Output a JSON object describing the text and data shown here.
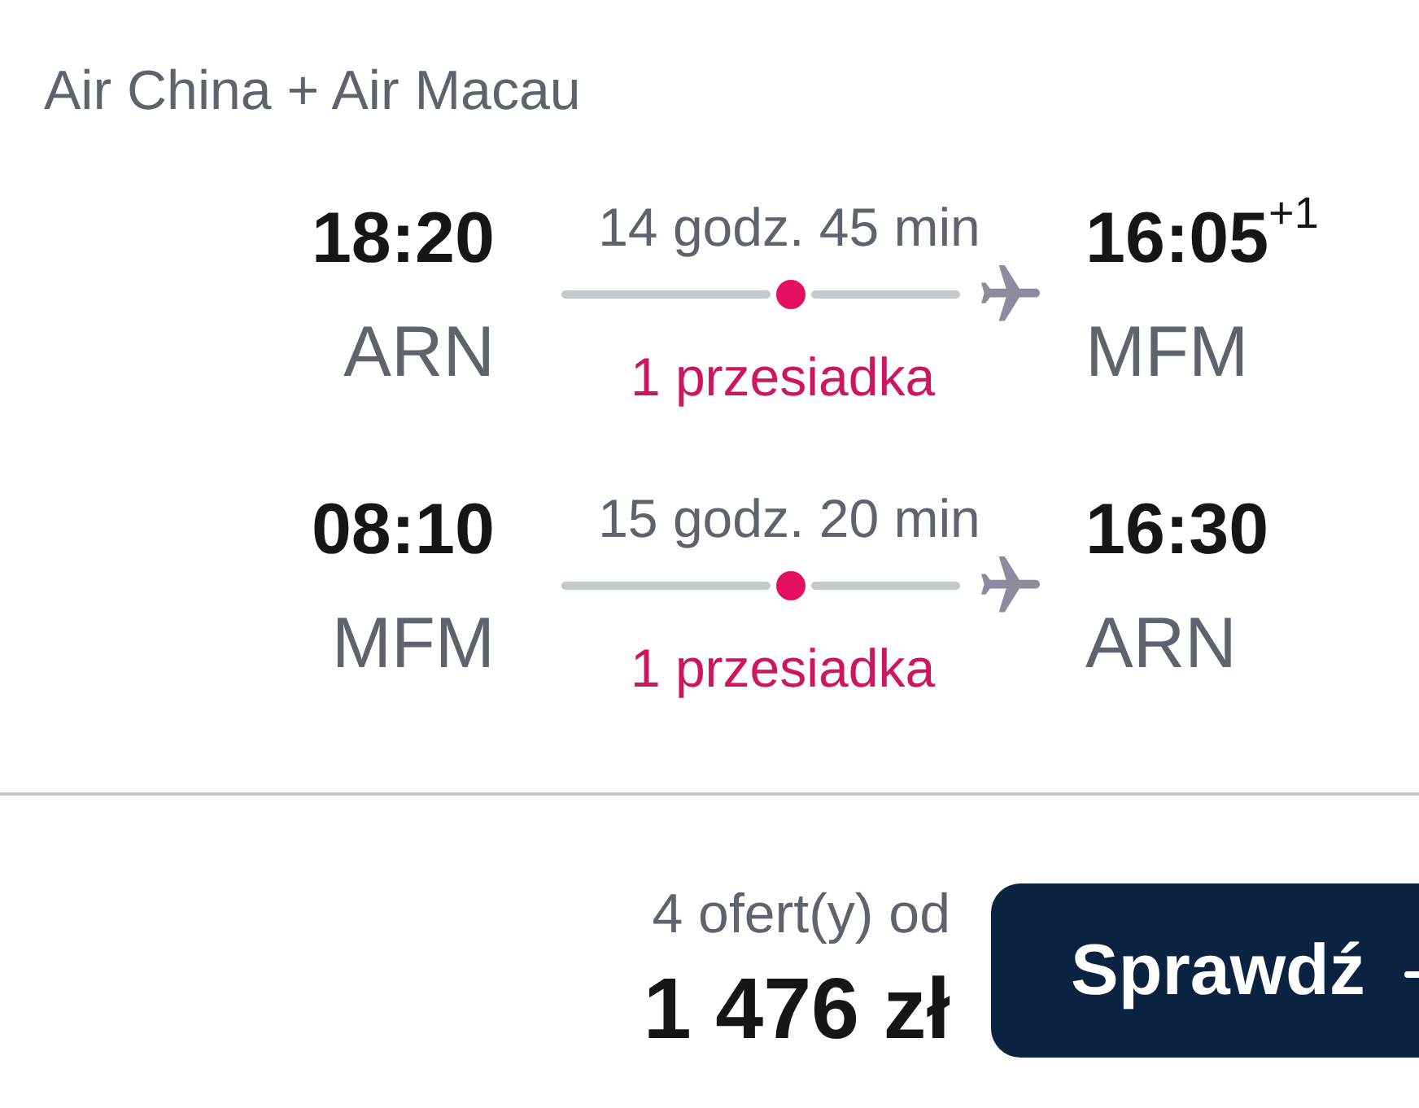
{
  "header": {
    "airlines": "Air China + Air Macau"
  },
  "legs": [
    {
      "departure": {
        "time": "18:20",
        "airport": "ARN"
      },
      "duration": "14 godz. 45 min",
      "stops": "1 przesiadka",
      "arrival": {
        "time": "16:05",
        "day_offset": "+1",
        "airport": "MFM"
      }
    },
    {
      "departure": {
        "time": "08:10",
        "airport": "MFM"
      },
      "duration": "15 godz. 20 min",
      "stops": "1 przesiadka",
      "arrival": {
        "time": "16:30",
        "airport": "ARN"
      }
    }
  ],
  "offer": {
    "count": "4 ofert(y) od",
    "price": "1 476 zł"
  },
  "button": {
    "label": "Sprawdź"
  }
}
